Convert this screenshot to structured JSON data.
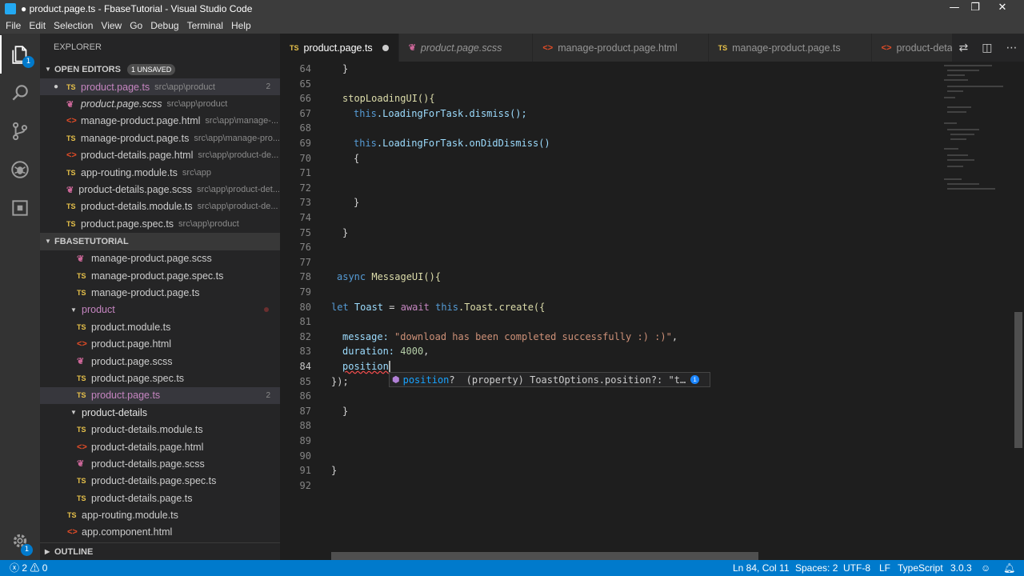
{
  "window": {
    "title": "● product.page.ts - FbaseTutorial - Visual Studio Code",
    "controls": [
      "—",
      "❐",
      "✕"
    ]
  },
  "menu": [
    "File",
    "Edit",
    "Selection",
    "View",
    "Go",
    "Debug",
    "Terminal",
    "Help"
  ],
  "activity": {
    "explorer_badge": "1",
    "settings_badge": "1"
  },
  "sidebar": {
    "title": "EXPLORER",
    "open_editors": {
      "label": "OPEN EDITORS",
      "badge": "1 UNSAVED",
      "items": [
        {
          "type": "TS",
          "name": "product.page.ts",
          "path": "src\\app\\product",
          "count": "2"
        },
        {
          "type": "scss",
          "name": "product.page.scss",
          "path": "src\\app\\product"
        },
        {
          "type": "html",
          "name": "manage-product.page.html",
          "path": "src\\app\\manage-..."
        },
        {
          "type": "TS",
          "name": "manage-product.page.ts",
          "path": "src\\app\\manage-pro..."
        },
        {
          "type": "html",
          "name": "product-details.page.html",
          "path": "src\\app\\product-de..."
        },
        {
          "type": "TS",
          "name": "app-routing.module.ts",
          "path": "src\\app"
        },
        {
          "type": "scss",
          "name": "product-details.page.scss",
          "path": "src\\app\\product-det..."
        },
        {
          "type": "TS",
          "name": "product-details.module.ts",
          "path": "src\\app\\product-de..."
        },
        {
          "type": "TS",
          "name": "product.page.spec.ts",
          "path": "src\\app\\product"
        }
      ]
    },
    "project": {
      "label": "FBASETUTORIAL",
      "items": [
        {
          "type": "scss",
          "name": "manage-product.page.scss"
        },
        {
          "type": "TS",
          "name": "manage-product.page.spec.ts"
        },
        {
          "type": "TS",
          "name": "manage-product.page.ts"
        },
        {
          "type": "folder",
          "name": "product"
        },
        {
          "type": "TS",
          "name": "product.module.ts"
        },
        {
          "type": "html",
          "name": "product.page.html"
        },
        {
          "type": "scss",
          "name": "product.page.scss"
        },
        {
          "type": "TS",
          "name": "product.page.spec.ts"
        },
        {
          "type": "TS",
          "name": "product.page.ts",
          "count": "2"
        },
        {
          "type": "folder",
          "name": "product-details"
        },
        {
          "type": "TS",
          "name": "product-details.module.ts"
        },
        {
          "type": "html",
          "name": "product-details.page.html"
        },
        {
          "type": "scss",
          "name": "product-details.page.scss"
        },
        {
          "type": "TS",
          "name": "product-details.page.spec.ts"
        },
        {
          "type": "TS",
          "name": "product-details.page.ts"
        },
        {
          "type": "TS",
          "name": "app-routing.module.ts"
        },
        {
          "type": "html",
          "name": "app.component.html"
        }
      ]
    },
    "outline_label": "OUTLINE"
  },
  "tabs": [
    {
      "type": "TS",
      "label": "product.page.ts"
    },
    {
      "type": "scss",
      "label": "product.page.scss"
    },
    {
      "type": "html",
      "label": "manage-product.page.html"
    },
    {
      "type": "TS",
      "label": "manage-product.page.ts"
    },
    {
      "type": "html",
      "label": "product-details.page.ht"
    }
  ],
  "editor": {
    "line_numbers": [
      "64",
      "65",
      "66",
      "67",
      "68",
      "69",
      "70",
      "71",
      "72",
      "73",
      "74",
      "75",
      "76",
      "77",
      "78",
      "79",
      "80",
      "81",
      "82",
      "83",
      "84",
      "85",
      "86",
      "87",
      "88",
      "89",
      "90",
      "91",
      "92"
    ],
    "code": {
      "l64": "}",
      "l66": "stopLoadingUI(){",
      "l67_this": "this",
      "l67_rest": ".LoadingForTask.dismiss();",
      "l69_this": "this",
      "l69_rest": ".LoadingForTask.onDidDismiss()",
      "l70": "{",
      "l73": "}",
      "l75": "}",
      "l78_async": "async",
      "l78_fn": "MessageUI(){",
      "l80_let": "let",
      "l80_var": "Toast",
      "l80_eq": " = ",
      "l80_await": "await",
      "l80_this": "this",
      "l80_rest": ".Toast.create({",
      "l82_key": "message:",
      "l82_str": "\"download has been completed successfully :) :)\"",
      "l82_end": ",",
      "l83_key": "duration:",
      "l83_num": "4000",
      "l83_end": ",",
      "l84_key": "position",
      "l85": "});",
      "l87": "}",
      "l91": "}"
    },
    "suggest": {
      "label": "position",
      "optional": "?",
      "detail": "(property) ToastOptions.position?: \"t…",
      "info": "i"
    }
  },
  "status": {
    "errors": "2",
    "warnings": "0",
    "position": "Ln 84, Col 11",
    "spaces": "Spaces: 2",
    "encoding": "UTF-8",
    "eol": "LF",
    "language": "TypeScript",
    "version": "3.0.3"
  },
  "colors": {
    "status_bar": "#007acc",
    "activity_bar": "#333333",
    "sidebar": "#252526",
    "editor": "#1e1e1e",
    "ts_icon": "#e8c24a",
    "html_icon": "#e34c26",
    "scss_icon": "#cd6799"
  }
}
